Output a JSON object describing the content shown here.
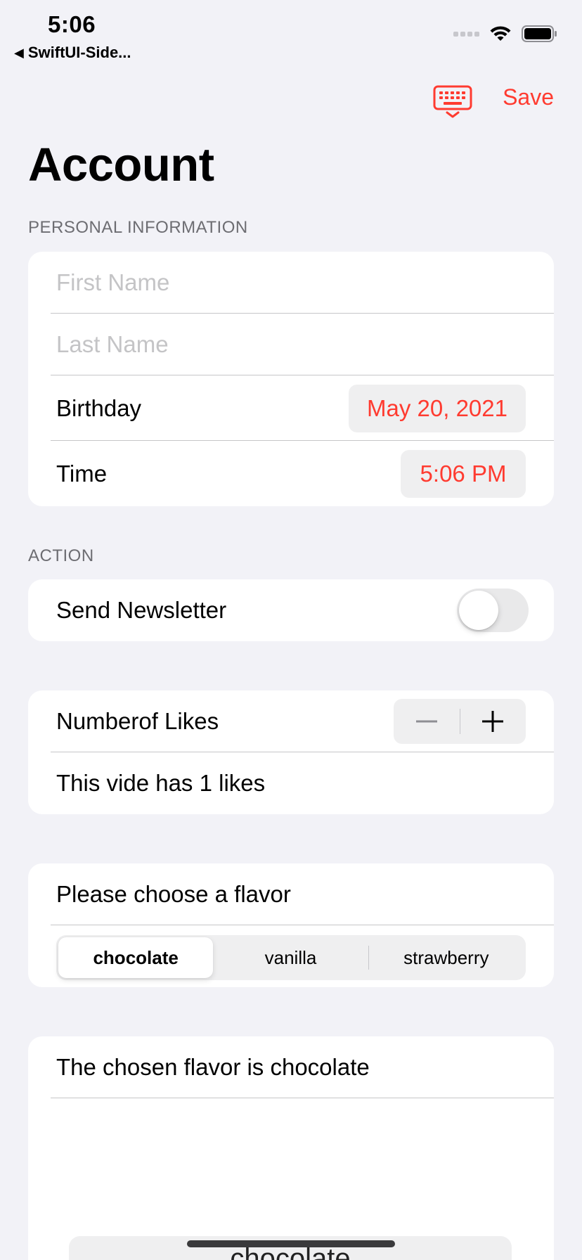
{
  "status_bar": {
    "time": "5:06",
    "back_app": "SwiftUI-Side..."
  },
  "nav": {
    "save_label": "Save"
  },
  "title": "Account",
  "personal_info": {
    "header": "PERSONAL INFORMATION",
    "first_name_placeholder": "First Name",
    "last_name_placeholder": "Last Name",
    "birthday_label": "Birthday",
    "birthday_value": "May 20, 2021",
    "time_label": "Time",
    "time_value": "5:06 PM"
  },
  "action": {
    "header": "ACTION",
    "newsletter_label": "Send Newsletter",
    "newsletter_on": false
  },
  "likes": {
    "label": "Numberof Likes",
    "summary": "This vide has 1 likes"
  },
  "flavor": {
    "prompt": "Please choose a flavor",
    "options": [
      "chocolate",
      "vanilla",
      "strawberry"
    ],
    "selected": "chocolate"
  },
  "chosen": {
    "text": "The chosen flavor is chocolate",
    "wheel_value": "chocolate"
  },
  "colors": {
    "accent": "#ff3b30",
    "background": "#f2f2f7"
  }
}
